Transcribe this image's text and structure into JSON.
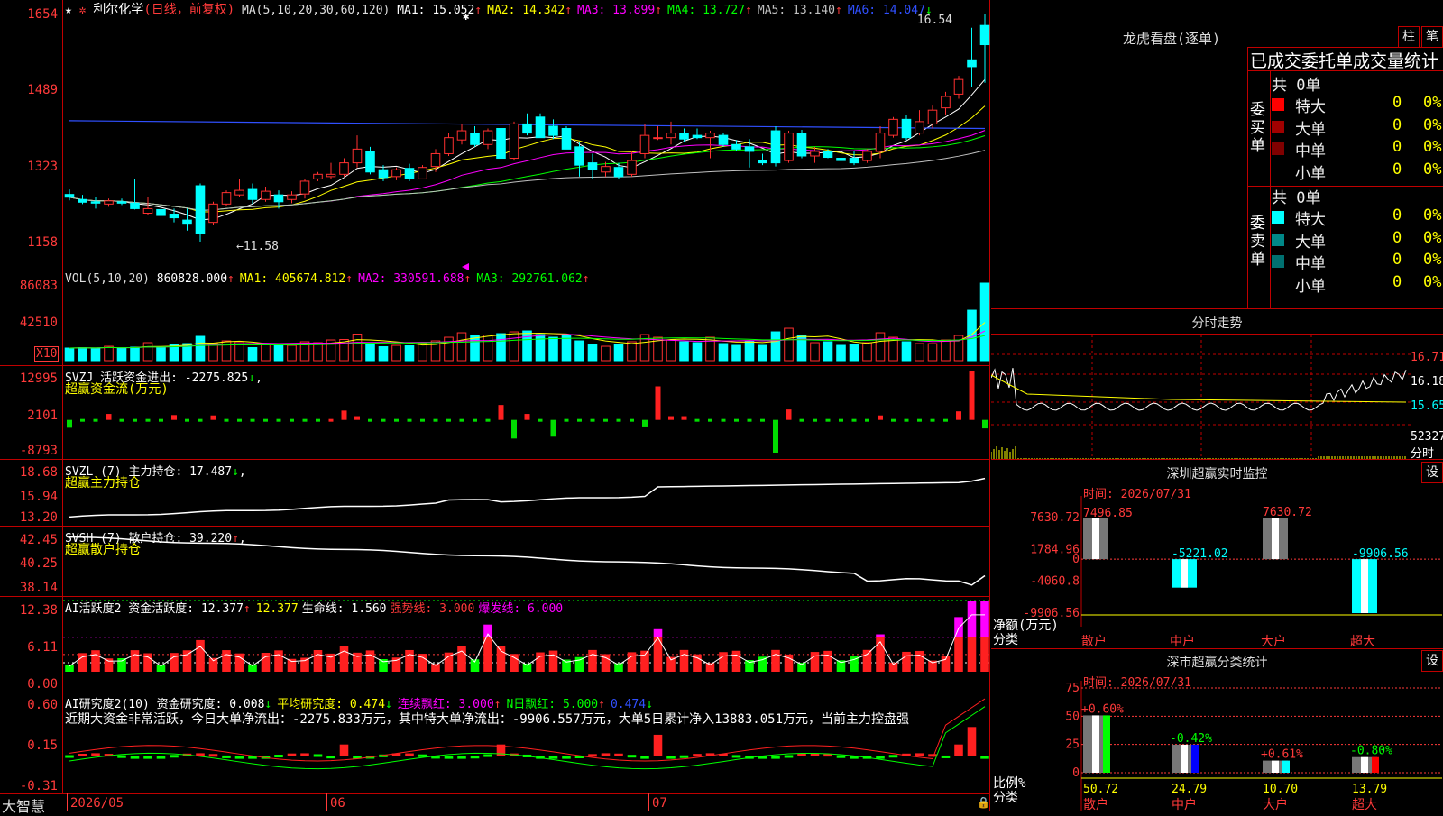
{
  "stock": {
    "name": "利尔化学",
    "period": "(日线，前复权)"
  },
  "price_panel": {
    "ma_label": "MA(5,10,20,30,60,120)",
    "mas": [
      {
        "text": "MA1: 15.052",
        "arrow": "↑",
        "color": "#ffffff",
        "arrow_color": "#ff3a3a"
      },
      {
        "text": "MA2: 14.342",
        "arrow": "↑",
        "color": "#ffff00",
        "arrow_color": "#ff3a3a"
      },
      {
        "text": "MA3: 13.899",
        "arrow": "↑",
        "color": "#ff00ff",
        "arrow_color": "#ff3a3a"
      },
      {
        "text": "MA4: 13.727",
        "arrow": "↑",
        "color": "#00ff00",
        "arrow_color": "#ff3a3a"
      },
      {
        "text": "MA5: 13.140",
        "arrow": "↑",
        "color": "#c0c0c0",
        "arrow_color": "#ff3a3a"
      },
      {
        "text": "MA6: 14.047",
        "arrow": "↓",
        "color": "#3050ff",
        "arrow_color": "#00ff00"
      }
    ],
    "axis": [
      "1654",
      "1489",
      "1323",
      "1158"
    ],
    "high_label": "16.54",
    "low_label": "11.58"
  },
  "vol_panel": {
    "label": "VOL(5,10,20)",
    "items": [
      {
        "text": "860828.000",
        "arrow": "↑",
        "color": "#ffffff"
      },
      {
        "text": "MA1: 405674.812",
        "arrow": "↑",
        "color": "#ffff00"
      },
      {
        "text": "MA2: 330591.688",
        "arrow": "↑",
        "color": "#ff00ff"
      },
      {
        "text": "MA3: 292761.062",
        "arrow": "↑",
        "color": "#00ff00"
      }
    ],
    "axis": [
      "86083",
      "42510"
    ],
    "unit": "X10"
  },
  "svzj_panel": {
    "line1": "SVZJ  活跃资金进出: -2275.825",
    "arrow": "↓",
    "line2": "超赢资金流(万元)",
    "axis": [
      "12995",
      "2101",
      "-8793"
    ]
  },
  "svzl_panel": {
    "line1": "SVZL (7) 主力持仓: 17.487",
    "arrow": "↓",
    "line2": "超赢主力持仓",
    "axis": [
      "18.68",
      "15.94",
      "13.20"
    ]
  },
  "svsh_panel": {
    "line1": "SVSH (7) 散户持仓: 39.220",
    "arrow": "↑",
    "line2": "超赢散户持仓",
    "axis": [
      "42.45",
      "40.25",
      "38.14"
    ]
  },
  "ai_active_panel": {
    "items": [
      {
        "text": "AI活跃度2 资金活跃度: 12.377",
        "arrow": "↑",
        "color": "#ffffff"
      },
      {
        "text": "12.377",
        "arrow": "",
        "color": "#ffff00"
      },
      {
        "text": "生命线: 1.560",
        "arrow": "",
        "color": "#ffffff"
      },
      {
        "text": "强势线: 3.000",
        "arrow": "",
        "color": "#ff3a3a"
      },
      {
        "text": "爆发线: 6.000",
        "arrow": "",
        "color": "#ff00ff"
      }
    ],
    "axis": [
      "12.38",
      "6.11",
      "0.00"
    ]
  },
  "ai_research_panel": {
    "items": [
      {
        "text": "AI研究度2(10) 资金研究度: 0.008",
        "arrow": "↓",
        "color": "#ffffff"
      },
      {
        "text": "平均研究度: 0.474",
        "arrow": "↓",
        "color": "#ffff00"
      },
      {
        "text": "连续飘红: 3.000",
        "arrow": "↑",
        "color": "#ff00ff"
      },
      {
        "text": "N日飘红: 5.000",
        "arrow": "↑",
        "color": "#00ff00"
      },
      {
        "text": "0.474",
        "arrow": "↓",
        "color": "#3050ff"
      }
    ],
    "comment": "近期大资金非常活跃，今日大单净流出：-2275.833万元，其中特大单净流出：-9906.557万元，大单5日累计净入13883.051万元，当前主力控盘强",
    "axis": [
      "0.60",
      "0.15",
      "-0.31"
    ]
  },
  "footer": {
    "brand": "大智慧",
    "months": [
      "2026/05",
      "06",
      "07"
    ]
  },
  "right": {
    "lh_title": "龙虎看盘(逐单)",
    "btn_bar": "柱",
    "btn_pen": "笔",
    "lh_header": "已成交委托单成交量统计",
    "buy": {
      "side": "委买单",
      "total": "共 0单",
      "rows": [
        {
          "name": "特大",
          "v1": "0",
          "v2": "0%",
          "color": "#ff0000"
        },
        {
          "name": "大单",
          "v1": "0",
          "v2": "0%",
          "color": "#a00000"
        },
        {
          "name": "中单",
          "v1": "0",
          "v2": "0%",
          "color": "#800000"
        },
        {
          "name": "小单",
          "v1": "0",
          "v2": "0%",
          "color": ""
        }
      ]
    },
    "sell": {
      "side": "委卖单",
      "total": "共 0单",
      "rows": [
        {
          "name": "特大",
          "v1": "0",
          "v2": "0%",
          "color": "#00ffff"
        },
        {
          "name": "大单",
          "v1": "0",
          "v2": "0%",
          "color": "#008888"
        },
        {
          "name": "中单",
          "v1": "0",
          "v2": "0%",
          "color": "#007070"
        },
        {
          "name": "小单",
          "v1": "0",
          "v2": "0%",
          "color": ""
        }
      ]
    },
    "intraday": {
      "title": "分时走势",
      "prices": [
        "16.71",
        "16.18",
        "15.65"
      ],
      "vol": "52327",
      "vol_unit": "分时"
    },
    "monitor": {
      "title": "深圳超赢实时监控",
      "set": "设",
      "time": "时间: 2026/07/31",
      "axis": [
        "7630.72",
        "1784.96",
        "0",
        "-4060.8",
        "-9906.56"
      ],
      "unit": "净额(万元)",
      "unit2": "分类",
      "bars": [
        {
          "label": "散户",
          "value": 7496.85,
          "text": "7496.85"
        },
        {
          "label": "中户",
          "value": -5221.02,
          "text": "-5221.02"
        },
        {
          "label": "大户",
          "value": 7630.72,
          "text": "7630.72"
        },
        {
          "label": "超大",
          "value": -9906.56,
          "text": "-9906.56"
        }
      ]
    },
    "classify": {
      "title": "深市超赢分类统计",
      "set": "设",
      "time": "时间: 2026/07/31",
      "axis": [
        "75",
        "50",
        "25",
        "0"
      ],
      "unit": "比例%",
      "unit2": "分类",
      "bars": [
        {
          "label": "散户",
          "value": 50.72,
          "pct": "+0.60%",
          "color": "#00ff00"
        },
        {
          "label": "中户",
          "value": 24.79,
          "pct": "-0.42%",
          "color": "#0000ff"
        },
        {
          "label": "大户",
          "value": 10.7,
          "pct": "+0.61%",
          "color": "#00ffff"
        },
        {
          "label": "超大",
          "value": 13.79,
          "pct": "-0.80%",
          "color": "#ff0000"
        }
      ]
    }
  },
  "chart_data": [
    {
      "type": "candlestick",
      "title": "利尔化学(日线，前复权)",
      "ylim": [
        11.58,
        16.54
      ],
      "yticks": [
        16.54,
        14.89,
        13.23,
        11.58
      ],
      "ohlc": [
        [
          12.61,
          12.72,
          12.48,
          12.55
        ],
        [
          12.5,
          12.6,
          12.4,
          12.44
        ],
        [
          12.45,
          12.55,
          12.3,
          12.42
        ],
        [
          12.4,
          12.52,
          12.34,
          12.47
        ],
        [
          12.45,
          12.52,
          12.38,
          12.42
        ],
        [
          12.42,
          12.95,
          12.28,
          12.3
        ],
        [
          12.2,
          12.55,
          12.16,
          12.3
        ],
        [
          12.28,
          12.45,
          12.1,
          12.15
        ],
        [
          12.18,
          12.3,
          12.0,
          12.1
        ],
        [
          12.05,
          12.3,
          11.82,
          11.98
        ],
        [
          12.8,
          12.85,
          11.58,
          11.75
        ],
        [
          12.0,
          12.45,
          11.95,
          12.4
        ],
        [
          12.4,
          12.7,
          12.35,
          12.65
        ],
        [
          12.6,
          12.95,
          12.55,
          12.7
        ],
        [
          12.72,
          12.85,
          12.4,
          12.5
        ],
        [
          12.5,
          12.78,
          12.45,
          12.68
        ],
        [
          12.6,
          12.7,
          12.3,
          12.45
        ],
        [
          12.5,
          12.68,
          12.42,
          12.6
        ],
        [
          12.62,
          12.95,
          12.52,
          12.9
        ],
        [
          12.95,
          13.1,
          12.9,
          13.05
        ],
        [
          13.0,
          13.3,
          12.95,
          13.05
        ],
        [
          13.05,
          13.4,
          13.0,
          13.3
        ],
        [
          13.3,
          13.9,
          13.2,
          13.6
        ],
        [
          13.55,
          13.65,
          13.05,
          13.1
        ],
        [
          13.15,
          13.25,
          12.9,
          12.98
        ],
        [
          13.0,
          13.2,
          12.92,
          13.15
        ],
        [
          13.18,
          13.28,
          12.9,
          12.95
        ],
        [
          12.95,
          13.25,
          12.95,
          13.2
        ],
        [
          13.22,
          13.6,
          13.1,
          13.5
        ],
        [
          13.5,
          13.95,
          13.45,
          13.85
        ],
        [
          13.8,
          14.15,
          13.7,
          14.0
        ],
        [
          13.95,
          14.1,
          13.65,
          13.7
        ],
        [
          13.7,
          14.05,
          13.6,
          14.0
        ],
        [
          14.05,
          14.1,
          13.35,
          13.4
        ],
        [
          13.4,
          14.2,
          13.35,
          14.15
        ],
        [
          14.15,
          14.38,
          13.9,
          13.95
        ],
        [
          14.3,
          14.38,
          13.85,
          13.85
        ],
        [
          14.1,
          14.25,
          13.82,
          13.9
        ],
        [
          14.05,
          14.1,
          13.6,
          13.6
        ],
        [
          13.65,
          13.75,
          13.0,
          13.25
        ],
        [
          13.3,
          13.5,
          12.95,
          13.15
        ],
        [
          13.1,
          13.32,
          13.0,
          13.22
        ],
        [
          13.2,
          13.3,
          12.95,
          13.0
        ],
        [
          13.05,
          13.55,
          13.0,
          13.35
        ],
        [
          13.5,
          14.15,
          13.4,
          13.9
        ],
        [
          13.85,
          14.1,
          13.8,
          13.85
        ],
        [
          13.85,
          14.2,
          13.7,
          13.95
        ],
        [
          13.95,
          14.05,
          13.75,
          13.82
        ],
        [
          13.9,
          14.05,
          13.82,
          13.85
        ],
        [
          13.85,
          14.0,
          13.4,
          13.95
        ],
        [
          13.9,
          13.95,
          13.65,
          13.7
        ],
        [
          13.7,
          13.8,
          13.55,
          13.6
        ],
        [
          13.65,
          13.82,
          13.2,
          13.55
        ],
        [
          13.35,
          13.5,
          13.25,
          13.3
        ],
        [
          14.0,
          14.1,
          13.22,
          13.3
        ],
        [
          13.35,
          14.0,
          13.3,
          13.95
        ],
        [
          13.95,
          14.02,
          13.4,
          13.45
        ],
        [
          13.45,
          13.65,
          13.3,
          13.55
        ],
        [
          13.55,
          13.6,
          13.4,
          13.42
        ],
        [
          13.4,
          13.6,
          13.3,
          13.35
        ],
        [
          13.4,
          13.55,
          13.25,
          13.3
        ],
        [
          13.35,
          13.6,
          13.3,
          13.55
        ],
        [
          13.55,
          14.1,
          13.4,
          13.95
        ],
        [
          13.9,
          14.3,
          13.85,
          14.25
        ],
        [
          14.25,
          14.35,
          13.8,
          13.85
        ],
        [
          13.95,
          14.45,
          13.9,
          14.2
        ],
        [
          14.15,
          14.55,
          14.05,
          14.45
        ],
        [
          14.5,
          14.85,
          14.35,
          14.75
        ],
        [
          14.8,
          15.2,
          14.7,
          15.12
        ],
        [
          15.55,
          16.25,
          14.95,
          15.4
        ],
        [
          16.3,
          16.54,
          15.05,
          15.88
        ]
      ],
      "ma": {
        "MA1": 15.052,
        "MA2": 14.342,
        "MA3": 13.899,
        "MA4": 13.727,
        "MA5": 13.14,
        "MA6": 14.047
      }
    },
    {
      "type": "bar",
      "title": "VOL",
      "ylim": [
        0,
        86083
      ],
      "values": [
        14000,
        14500,
        14000,
        16000,
        13500,
        15000,
        20000,
        14500,
        18000,
        19000,
        27000,
        19000,
        22000,
        21000,
        14500,
        18500,
        16500,
        17000,
        21000,
        20000,
        23000,
        23500,
        29500,
        19000,
        15500,
        17000,
        16500,
        19000,
        22000,
        26000,
        31000,
        28000,
        28500,
        30000,
        32000,
        33000,
        29000,
        26000,
        28000,
        22000,
        17500,
        16000,
        18500,
        21000,
        29000,
        26000,
        23000,
        21000,
        20000,
        26000,
        19000,
        17000,
        22000,
        17000,
        32000,
        36000,
        27500,
        20000,
        21000,
        17000,
        18500,
        20000,
        31000,
        26000,
        21000,
        19000,
        19000,
        23000,
        28000,
        56000,
        86083
      ],
      "unit": "X10"
    },
    {
      "type": "bar",
      "title": "活跃资金进出",
      "ylim": [
        -8793,
        12995
      ],
      "values": [
        -2100,
        -600,
        -700,
        1600,
        -500,
        -800,
        -600,
        -500,
        1300,
        -700,
        -500,
        1200,
        -400,
        -500,
        -700,
        -600,
        -500,
        -700,
        -500,
        -500,
        700,
        2500,
        1000,
        -700,
        -500,
        -600,
        -400,
        -500,
        -400,
        -500,
        -500,
        -600,
        -900,
        4000,
        -5000,
        1600,
        -600,
        -4500,
        -700,
        -500,
        -500,
        -600,
        -400,
        -500,
        -2000,
        9000,
        1000,
        1000,
        -800,
        -600,
        -500,
        -700,
        -500,
        -600,
        -8793,
        2800,
        -700,
        -600,
        -500,
        -700,
        -600,
        -500,
        1200,
        -600,
        -600,
        -500,
        -700,
        -600,
        2300,
        12995,
        -2275.825
      ]
    },
    {
      "type": "line",
      "title": "主力持仓",
      "ylim": [
        13.2,
        18.68
      ],
      "last": 17.487
    },
    {
      "type": "line",
      "title": "散户持仓",
      "ylim": [
        38.14,
        42.45
      ],
      "last": 39.22
    },
    {
      "type": "bar",
      "title": "资金活跃度",
      "ylim": [
        0,
        12.38
      ],
      "lines": {
        "生命线": 1.56,
        "强势线": 3.0,
        "爆发线": 6.0
      },
      "last": 12.377
    },
    {
      "type": "bar",
      "title": "资金研究度",
      "ylim": [
        -0.31,
        0.6
      ],
      "last": 0.008
    },
    {
      "type": "bar",
      "title": "深圳超赢实时监控",
      "categories": [
        "散户",
        "中户",
        "大户",
        "超大"
      ],
      "values": [
        7496.85,
        -5221.02,
        7630.72,
        -9906.56
      ],
      "ylim": [
        -9906.56,
        7630.72
      ]
    },
    {
      "type": "bar",
      "title": "深市超赢分类统计",
      "categories": [
        "散户",
        "中户",
        "大户",
        "超大"
      ],
      "values": [
        50.72,
        24.79,
        10.7,
        13.79
      ],
      "ylim": [
        0,
        75
      ]
    }
  ]
}
